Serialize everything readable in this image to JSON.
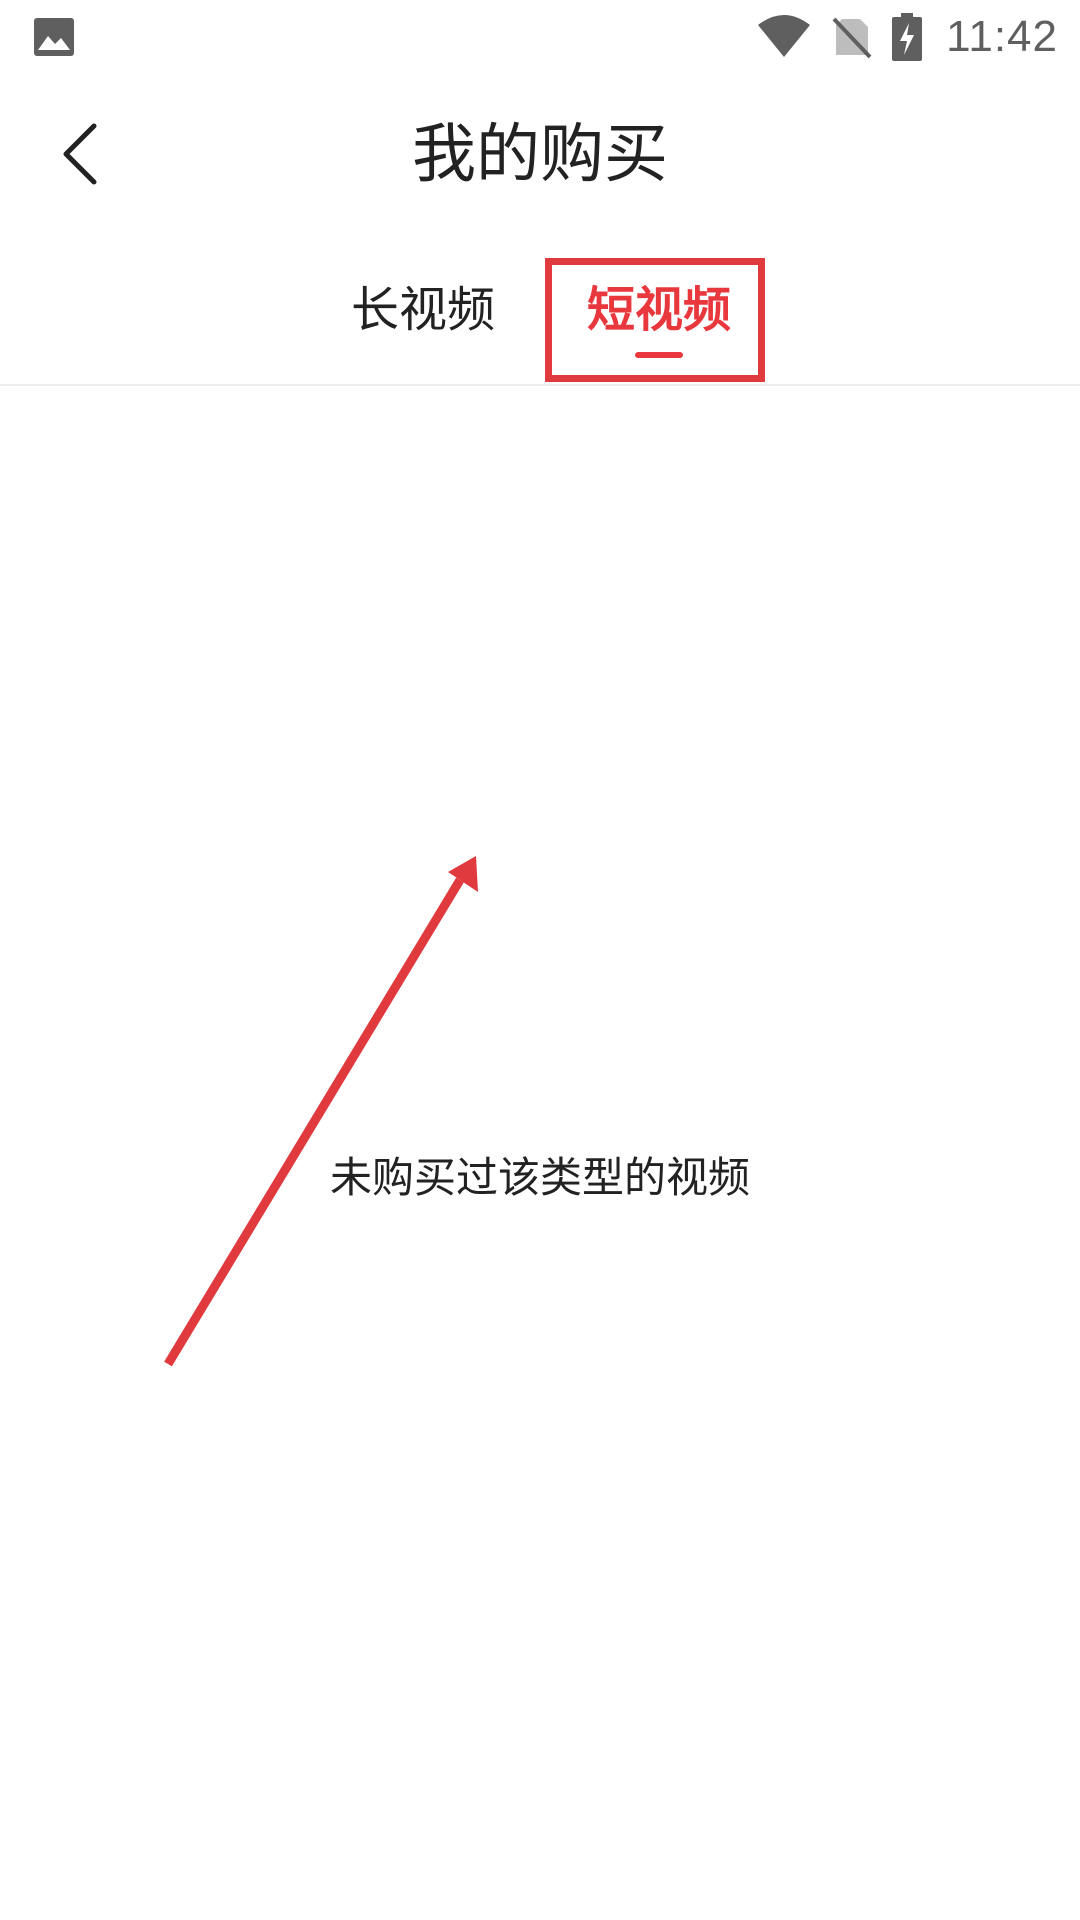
{
  "status_bar": {
    "left_icon": "image-icon",
    "icons": [
      "wifi-icon",
      "no-sim-icon",
      "battery-charging-icon"
    ],
    "time": "11:42"
  },
  "header": {
    "back_icon": "chevron-left-icon",
    "title": "我的购买"
  },
  "tabs": [
    {
      "label": "长视频",
      "selected": false
    },
    {
      "label": "短视频",
      "selected": true
    }
  ],
  "empty_state": {
    "message": "未购买过该类型的视频"
  },
  "colors": {
    "accent": "#e8383e",
    "annotation": "#e03a3e",
    "text": "#222222",
    "status_icons": "#5f5f5f"
  }
}
